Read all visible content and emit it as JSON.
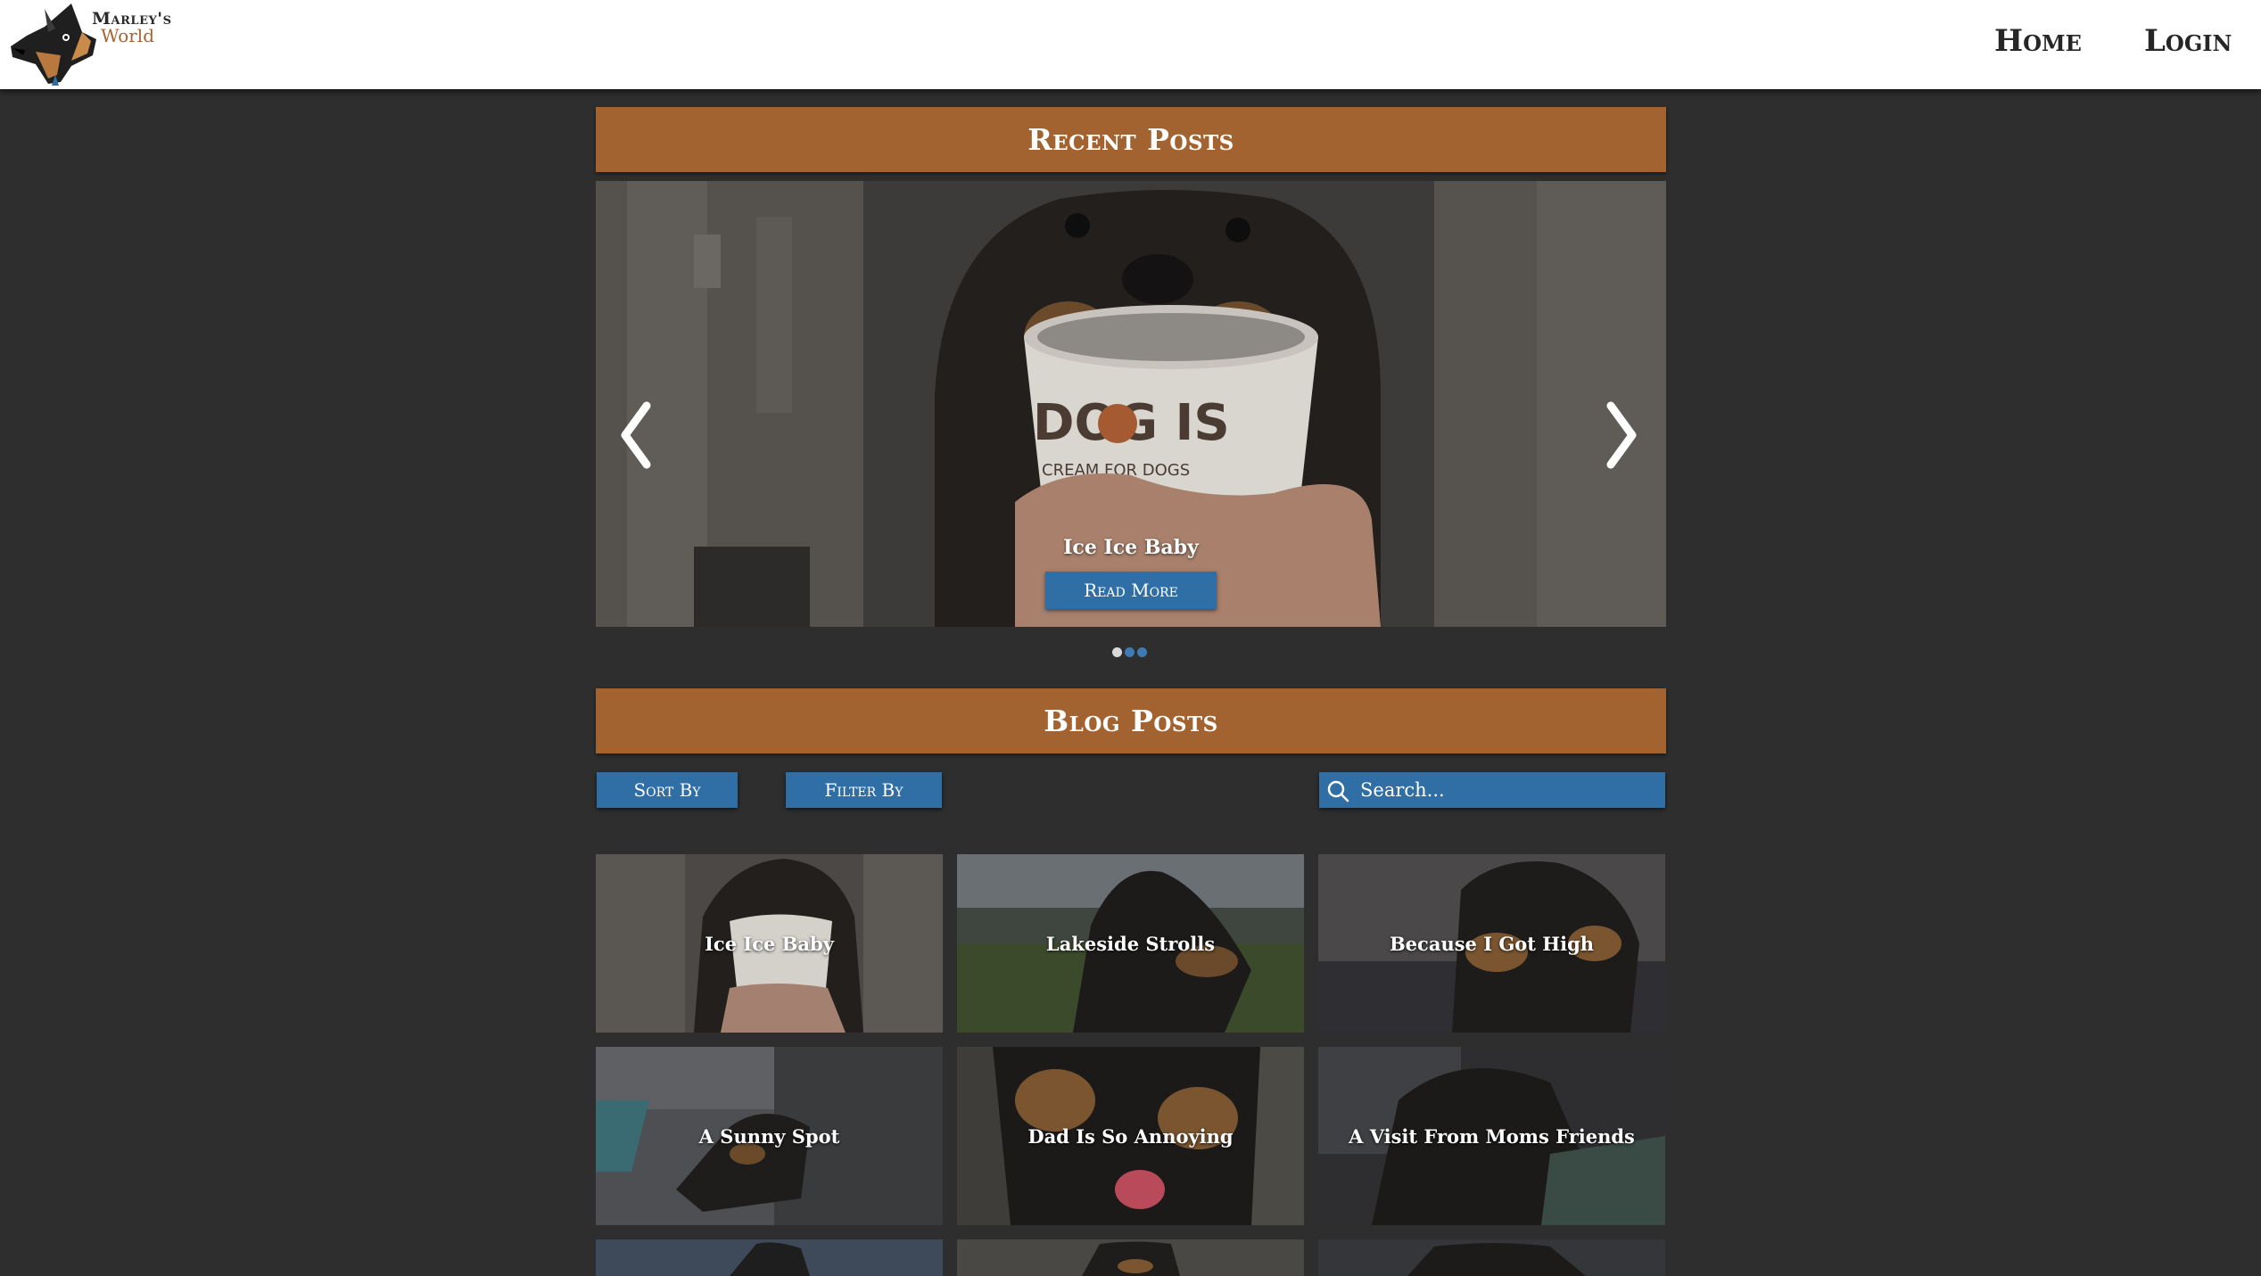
{
  "site": {
    "logo_title": "Marley's",
    "logo_subtitle": "World"
  },
  "nav": {
    "items": [
      {
        "label": "Home"
      },
      {
        "label": "Login"
      }
    ]
  },
  "recent": {
    "heading": "Recent Posts",
    "slide": {
      "title": "Ice Ice Baby",
      "button_label": "Read More",
      "cup_text": "DOG IS",
      "cup_subtext": "CREAM FOR DOGS"
    },
    "slide_count": 3,
    "active_slide": 1
  },
  "blog": {
    "heading": "Blog Posts",
    "sort_label": "Sort By",
    "filter_label": "Filter By",
    "search_placeholder": "Search...",
    "posts": [
      {
        "title": "Ice Ice Baby"
      },
      {
        "title": "Lakeside Strolls"
      },
      {
        "title": "Because I Got High"
      },
      {
        "title": "A Sunny Spot"
      },
      {
        "title": "Dad Is So Annoying"
      },
      {
        "title": "A Visit From Moms Friends"
      }
    ]
  },
  "colors": {
    "banner": "#a36331",
    "button": "#2f6fa6",
    "background": "#2e2e2e",
    "header": "#ffffff"
  },
  "icons": {
    "prev": "chevron-left-icon",
    "next": "chevron-right-icon",
    "search": "search-icon",
    "logo": "dog-head-logo"
  }
}
